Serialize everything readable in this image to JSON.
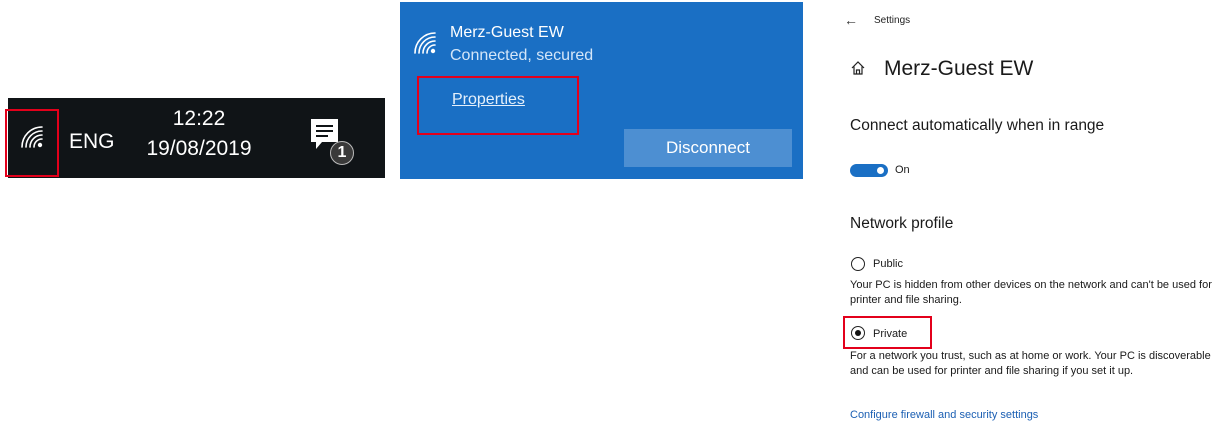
{
  "taskbar": {
    "language": "ENG",
    "time": "12:22",
    "date": "19/08/2019",
    "notification_count": "1",
    "icons": {
      "wifi": "wifi-icon",
      "notifications": "notification-center-icon"
    }
  },
  "wifi_flyout": {
    "network_name": "Merz-Guest EW",
    "status": "Connected, secured",
    "properties_link": "Properties",
    "disconnect_button": "Disconnect",
    "accent_color": "#1a6fc4"
  },
  "settings": {
    "back_label": "←",
    "app_title": "Settings",
    "page_title": "Merz-Guest EW",
    "connect_auto_label": "Connect automatically when in range",
    "toggle_state": "On",
    "network_profile_heading": "Network profile",
    "public_label": "Public",
    "public_desc": "Your PC is hidden from other devices on the network and can't be used for printer and file sharing.",
    "private_label": "Private",
    "private_desc": "For a network you trust, such as at home or work. Your PC is discoverable and can be used for printer and file sharing if you set it up.",
    "selected_profile": "Private",
    "firewall_link": "Configure firewall and security settings"
  },
  "highlight_color": "#e3001b"
}
